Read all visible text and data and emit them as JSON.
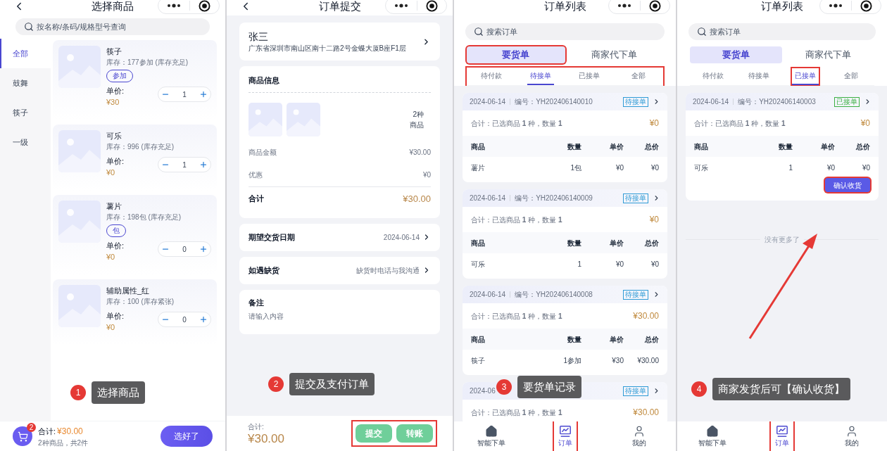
{
  "screens": [
    {
      "kind": "products",
      "title": "选择商品",
      "back": true,
      "search": {
        "placeholder": "按名称/条码/规格型号查询"
      },
      "categories": [
        {
          "label": "全部",
          "selected": true
        },
        {
          "label": "鼓舞",
          "selected": false
        },
        {
          "label": "筷子",
          "selected": false
        },
        {
          "label": "一级",
          "selected": false
        }
      ],
      "products": [
        {
          "name": "筷子",
          "stock": "库存：177参加 (库存充足)",
          "tag": "参加",
          "price_label": "单价:",
          "price": "¥30",
          "quantity": "1"
        },
        {
          "name": "可乐",
          "stock": "库存：996 (库存充足)",
          "price_label": "单价:",
          "price": "¥0",
          "quantity": "1"
        },
        {
          "name": "薯片",
          "stock": "库存：198包 (库存充足)",
          "tag": "包",
          "price_label": "单价:",
          "price": "¥0",
          "quantity": "0"
        },
        {
          "name": "辅助属性_红",
          "stock": "库存：100 (库存紧张)",
          "price_label": "单价:",
          "price": "¥0",
          "quantity": "0"
        }
      ],
      "cart": {
        "badge": "2",
        "total_label": "合计:",
        "total": "¥30.00",
        "summary": "2种商品，共2件",
        "button": "选好了"
      },
      "callout": {
        "number": "1",
        "text": "选择商品"
      }
    },
    {
      "kind": "checkout",
      "title": "订单提交",
      "back": true,
      "address": {
        "name": "张三",
        "detail": "广东省深圳市南山区南十二路2号金蝶大厦B座F1层"
      },
      "goods": {
        "heading": "商品信息",
        "thumbnails": [
          {
            "kind": "placeholder"
          },
          {
            "kind": "placeholder"
          }
        ],
        "count": "2种",
        "count_unit": "商品",
        "lines": [
          {
            "label": "商品金额",
            "value": "¥30.00"
          },
          {
            "label": "优惠",
            "value": "¥0"
          }
        ],
        "total_label": "合计",
        "total": "¥30.00"
      },
      "options": [
        {
          "label": "期望交货日期",
          "value": "2024-06-14"
        },
        {
          "label": "如遇缺货",
          "value": "缺货时电话与我沟通"
        }
      ],
      "remark": {
        "label": "备注",
        "placeholder": "请输入内容"
      },
      "footer": {
        "total_label": "合计:",
        "total": "¥30.00",
        "highlighted": true,
        "buttons": [
          "提交",
          "转账"
        ]
      },
      "callout": {
        "number": "2",
        "text": "提交及支付订单"
      }
    },
    {
      "kind": "orders",
      "title": "订单列表",
      "back": false,
      "search": {
        "placeholder": "搜索订单"
      },
      "tabs": [
        {
          "label": "要货单",
          "selected": true,
          "highlighted": true
        },
        {
          "label": "商家代下单",
          "selected": false,
          "highlighted": false
        }
      ],
      "subtabs": {
        "highlighted": true,
        "items": [
          {
            "label": "待付款",
            "selected": false,
            "highlighted": false
          },
          {
            "label": "待接单",
            "selected": true,
            "highlighted": false
          },
          {
            "label": "已接单",
            "selected": false,
            "highlighted": false
          },
          {
            "label": "全部",
            "selected": false,
            "highlighted": false
          }
        ]
      },
      "orders": [
        {
          "date": "2024-06-14",
          "number": "编号：YH202406140010",
          "status": {
            "text": "待接单",
            "color": "#2f9bd6"
          },
          "summary": "合计：已选商品 **1** 种，数量 **1**",
          "total": "¥0",
          "columns": [
            "商品",
            "数量",
            "单价",
            "总价"
          ],
          "rows": [
            [
              "薯片",
              "1包",
              "¥0",
              "¥0"
            ]
          ]
        },
        {
          "date": "2024-06-14",
          "number": "编号：YH202406140009",
          "status": {
            "text": "待接单",
            "color": "#2f9bd6"
          },
          "summary": "合计：已选商品 **1** 种，数量 **1**",
          "total": "¥0",
          "columns": [
            "商品",
            "数量",
            "单价",
            "总价"
          ],
          "rows": [
            [
              "可乐",
              "1",
              "¥0",
              "¥0"
            ]
          ]
        },
        {
          "date": "2024-06-14",
          "number": "编号：YH202406140008",
          "status": {
            "text": "待接单",
            "color": "#2f9bd6"
          },
          "summary": "合计：已选商品 **1** 种，数量 **1**",
          "total": "¥30.00",
          "columns": [
            "商品",
            "数量",
            "单价",
            "总价"
          ],
          "rows": [
            [
              "筷子",
              "1参加",
              "¥30",
              "¥30.00"
            ]
          ]
        },
        {
          "date": "2024-06",
          "status": {
            "text": "待接单",
            "color": "#2f9bd6"
          },
          "summary": "合计：已选商品 **1** 种，数量 **1**",
          "total": "¥30.00"
        }
      ],
      "nav": [
        {
          "label": "智能下单",
          "selected": false,
          "highlighted": false
        },
        {
          "label": "订单",
          "selected": true,
          "highlighted": true
        },
        {
          "label": "我的",
          "selected": false,
          "highlighted": false
        }
      ],
      "callout": {
        "number": "3",
        "text": "要货单记录"
      }
    },
    {
      "kind": "orders",
      "title": "订单列表",
      "back": false,
      "search": {
        "placeholder": "搜索订单"
      },
      "tabs": [
        {
          "label": "要货单",
          "selected": true,
          "highlighted": false
        },
        {
          "label": "商家代下单",
          "selected": false,
          "highlighted": false
        }
      ],
      "subtabs": {
        "highlighted": false,
        "items": [
          {
            "label": "待付款",
            "selected": false,
            "highlighted": false
          },
          {
            "label": "待接单",
            "selected": false,
            "highlighted": false
          },
          {
            "label": "已接单",
            "selected": true,
            "highlighted": true
          },
          {
            "label": "全部",
            "selected": false,
            "highlighted": false
          }
        ]
      },
      "orders": [
        {
          "date": "2024-06-14",
          "number": "编号：YH202406140003",
          "status": {
            "text": "已接单",
            "color": "#3cb043"
          },
          "summary": "合计：已选商品 **1** 种，数量 **1**",
          "total": "¥0",
          "columns": [
            "商品",
            "数量",
            "单价",
            "总价"
          ],
          "rows": [
            [
              "可乐",
              "1",
              "¥0",
              "¥0"
            ]
          ],
          "action": {
            "label": "确认收货",
            "highlighted": true
          }
        }
      ],
      "end_note": "没有更多了",
      "arrow": true,
      "nav": [
        {
          "label": "智能下单",
          "selected": false,
          "highlighted": false
        },
        {
          "label": "订单",
          "selected": true,
          "highlighted": true
        },
        {
          "label": "我的",
          "selected": false,
          "highlighted": false
        }
      ],
      "callout": {
        "number": "4",
        "text": "商家发货后可【确认收货】"
      }
    }
  ]
}
